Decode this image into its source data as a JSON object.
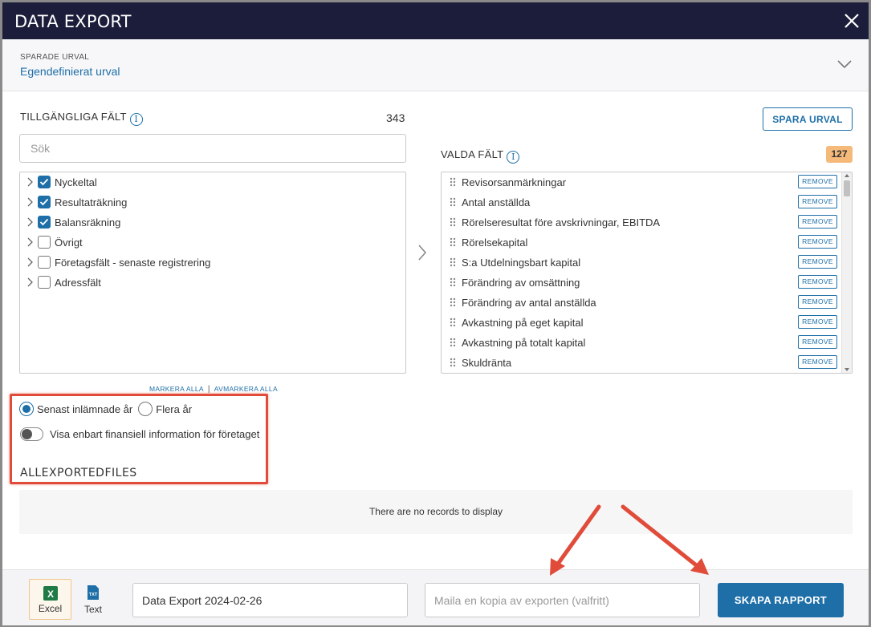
{
  "header": {
    "title": "DATA EXPORT"
  },
  "saved_selection": {
    "label": "SPARADE URVAL",
    "value": "Egendefinierat urval"
  },
  "available_fields": {
    "title": "TILLGÄNGLIGA FÄLT",
    "count": "343",
    "search_placeholder": "Sök",
    "items": [
      {
        "label": "Nyckeltal",
        "checked": true
      },
      {
        "label": "Resultaträkning",
        "checked": true
      },
      {
        "label": "Balansräkning",
        "checked": true
      },
      {
        "label": "Övrigt",
        "checked": false
      },
      {
        "label": "Företagsfält - senaste registrering",
        "checked": false
      },
      {
        "label": "Adressfält",
        "checked": false
      }
    ],
    "select_all": "MARKERA ALLA",
    "separator": "|",
    "deselect_all": "AVMARKERA ALLA"
  },
  "save_selection_button": "SPARA URVAL",
  "selected_fields": {
    "title": "VALDA FÄLT",
    "count": "127",
    "remove_label": "REMOVE",
    "items": [
      "Revisorsanmärkningar",
      "Antal anställda",
      "Rörelseresultat före avskrivningar, EBITDA",
      "Rörelsekapital",
      "S:a Utdelningsbart kapital",
      "Förändring av omsättning",
      "Förändring av antal anställda",
      "Avkastning på eget kapital",
      "Avkastning på totalt kapital",
      "Skuldränta"
    ]
  },
  "year_options": {
    "latest": "Senast inlämnade år",
    "multiple": "Flera år",
    "selected": "latest"
  },
  "financial_toggle": {
    "label": "Visa enbart finansiell information för företaget",
    "on": false
  },
  "all_exported_files": {
    "title": "ALLEXPORTEDFILES",
    "empty_message": "There are no records to display"
  },
  "footer": {
    "formats": [
      {
        "label": "Excel",
        "icon": "excel-icon",
        "active": true
      },
      {
        "label": "Text",
        "icon": "text-file-icon",
        "active": false
      }
    ],
    "excel_icon_text": "X",
    "text_icon_text": "TXT",
    "export_name_value": "Data Export 2024-02-26",
    "email_placeholder": "Maila en kopia av exporten (valfritt)",
    "create_button": "SKAPA RAPPORT"
  },
  "colors": {
    "header_bg": "#1c1d3a",
    "accent": "#1e6fa8",
    "badge": "#f5b97a",
    "annotation": "#e04b3a"
  }
}
